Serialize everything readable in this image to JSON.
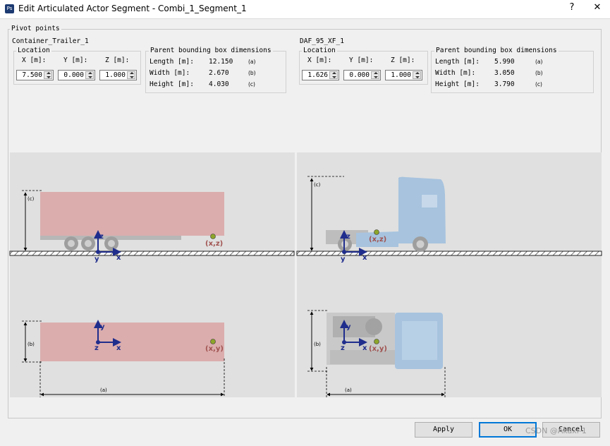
{
  "window": {
    "title": "Edit Articulated Actor Segment - Combi_1_Segment_1",
    "icon_text": "Ps",
    "help": "?",
    "close": "✕"
  },
  "pivot_points": {
    "title": "Pivot points",
    "location_label": "Location",
    "parent_bbox_label": "Parent bounding box dimensions",
    "x_label": "X [m]:",
    "y_label": "Y [m]:",
    "z_label": "Z [m]:",
    "length_label": "Length [m]:",
    "width_label": "Width [m]:",
    "height_label": "Height [m]:",
    "tag_a": "(a)",
    "tag_b": "(b)",
    "tag_c": "(c)",
    "left": {
      "name": "Container_Trailer_1",
      "x": "7.500",
      "y": "0.000",
      "z": "1.000",
      "length": "12.150",
      "width": "2.670",
      "height": "4.030"
    },
    "right": {
      "name": "DAF_95_XF_1",
      "x": "1.626",
      "y": "0.000",
      "z": "1.000",
      "length": "5.990",
      "width": "3.050",
      "height": "3.790"
    }
  },
  "diagram": {
    "axis_x": "x",
    "axis_y": "y",
    "axis_z": "z",
    "pivot_xz": "(x,z)",
    "pivot_xy": "(x,y)",
    "tag_a": "(a)",
    "tag_b": "(b)",
    "tag_c": "(c)"
  },
  "buttons": {
    "apply": "Apply",
    "ok": "OK",
    "cancel": "Cancel"
  },
  "watermark": "CSDN @Akaxi-1",
  "colors": {
    "trailer": "#d9a3a3",
    "truck": "#a7c3de",
    "axis": "#1f2d8c",
    "pivot_label": "#a0524f"
  }
}
